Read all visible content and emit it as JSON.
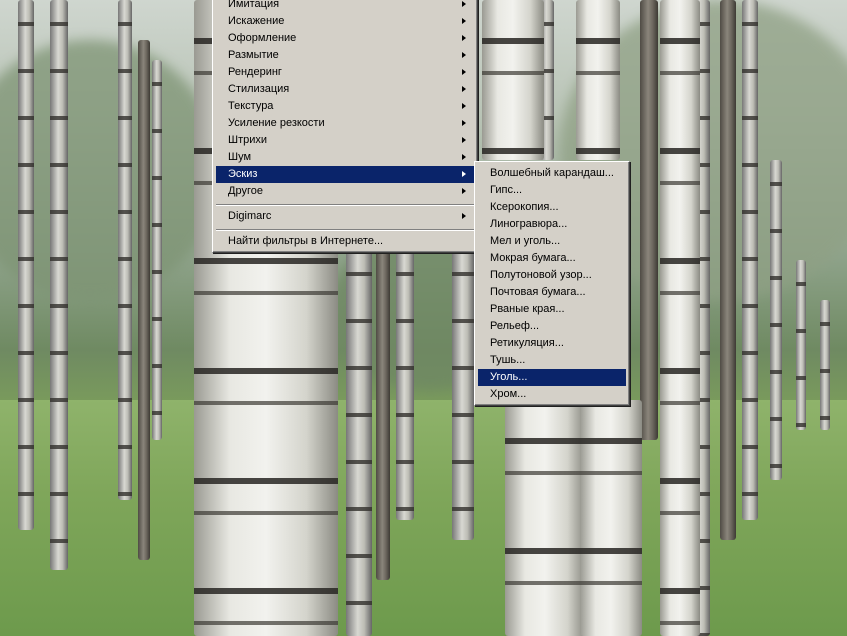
{
  "filter_menu": {
    "items": [
      {
        "label": "Имитация",
        "has_submenu": true
      },
      {
        "label": "Искажение",
        "has_submenu": true
      },
      {
        "label": "Оформление",
        "has_submenu": true
      },
      {
        "label": "Размытие",
        "has_submenu": true
      },
      {
        "label": "Рендеринг",
        "has_submenu": true
      },
      {
        "label": "Стилизация",
        "has_submenu": true
      },
      {
        "label": "Текстура",
        "has_submenu": true
      },
      {
        "label": "Усиление резкости",
        "has_submenu": true
      },
      {
        "label": "Штрихи",
        "has_submenu": true
      },
      {
        "label": "Шум",
        "has_submenu": true
      },
      {
        "label": "Эскиз",
        "has_submenu": true,
        "selected": true
      },
      {
        "label": "Другое",
        "has_submenu": true
      }
    ],
    "digimarc": {
      "label": "Digimarc",
      "has_submenu": true
    },
    "online": {
      "label": "Найти фильтры в Интернете..."
    }
  },
  "sketch_submenu": {
    "items": [
      {
        "label": "Волшебный карандаш..."
      },
      {
        "label": "Гипс..."
      },
      {
        "label": "Ксерокопия..."
      },
      {
        "label": "Линогравюра..."
      },
      {
        "label": "Мел и уголь..."
      },
      {
        "label": "Мокрая бумага..."
      },
      {
        "label": "Полутоновой узор..."
      },
      {
        "label": "Почтовая бумага..."
      },
      {
        "label": "Рваные края..."
      },
      {
        "label": "Рельеф..."
      },
      {
        "label": "Ретикуляция..."
      },
      {
        "label": "Тушь..."
      },
      {
        "label": "Уголь...",
        "selected": true
      },
      {
        "label": "Хром..."
      }
    ]
  },
  "colors": {
    "menu_bg": "#d4d0c8",
    "highlight": "#0a246a",
    "highlight_text": "#ffffff"
  }
}
